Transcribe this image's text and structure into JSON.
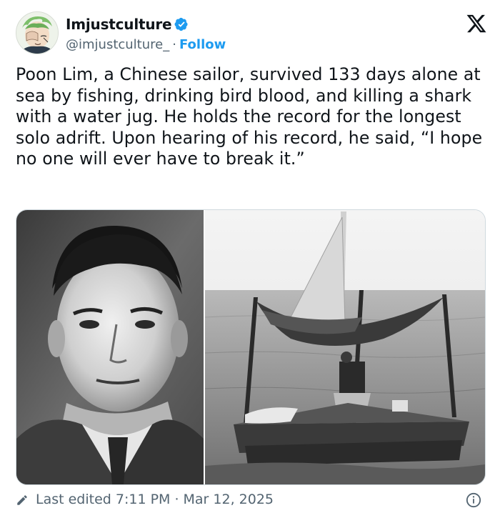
{
  "author": {
    "display_name": "Imjustculture",
    "handle": "@imjustculture_",
    "separator": "·",
    "follow_label": "Follow",
    "verified": true
  },
  "tweet": {
    "text": "Poon Lim, a Chinese sailor, survived 133 days alone at sea by fishing, drinking bird blood, and killing a shark with a water jug. He holds the record for the longest solo adrift. Upon hearing of his record, he said, “I hope no one will ever have to break it.”"
  },
  "footer": {
    "edited_label": "Last edited 7:11 PM",
    "separator": "·",
    "date": "Mar 12, 2025"
  },
  "colors": {
    "accent": "#1d9bf0",
    "text": "#0f1419",
    "muted": "#536471",
    "border": "#cfd9de"
  },
  "icons": {
    "verified": "verified-badge-icon",
    "brand": "x-logo-icon",
    "edit": "pencil-icon",
    "info": "info-icon"
  }
}
